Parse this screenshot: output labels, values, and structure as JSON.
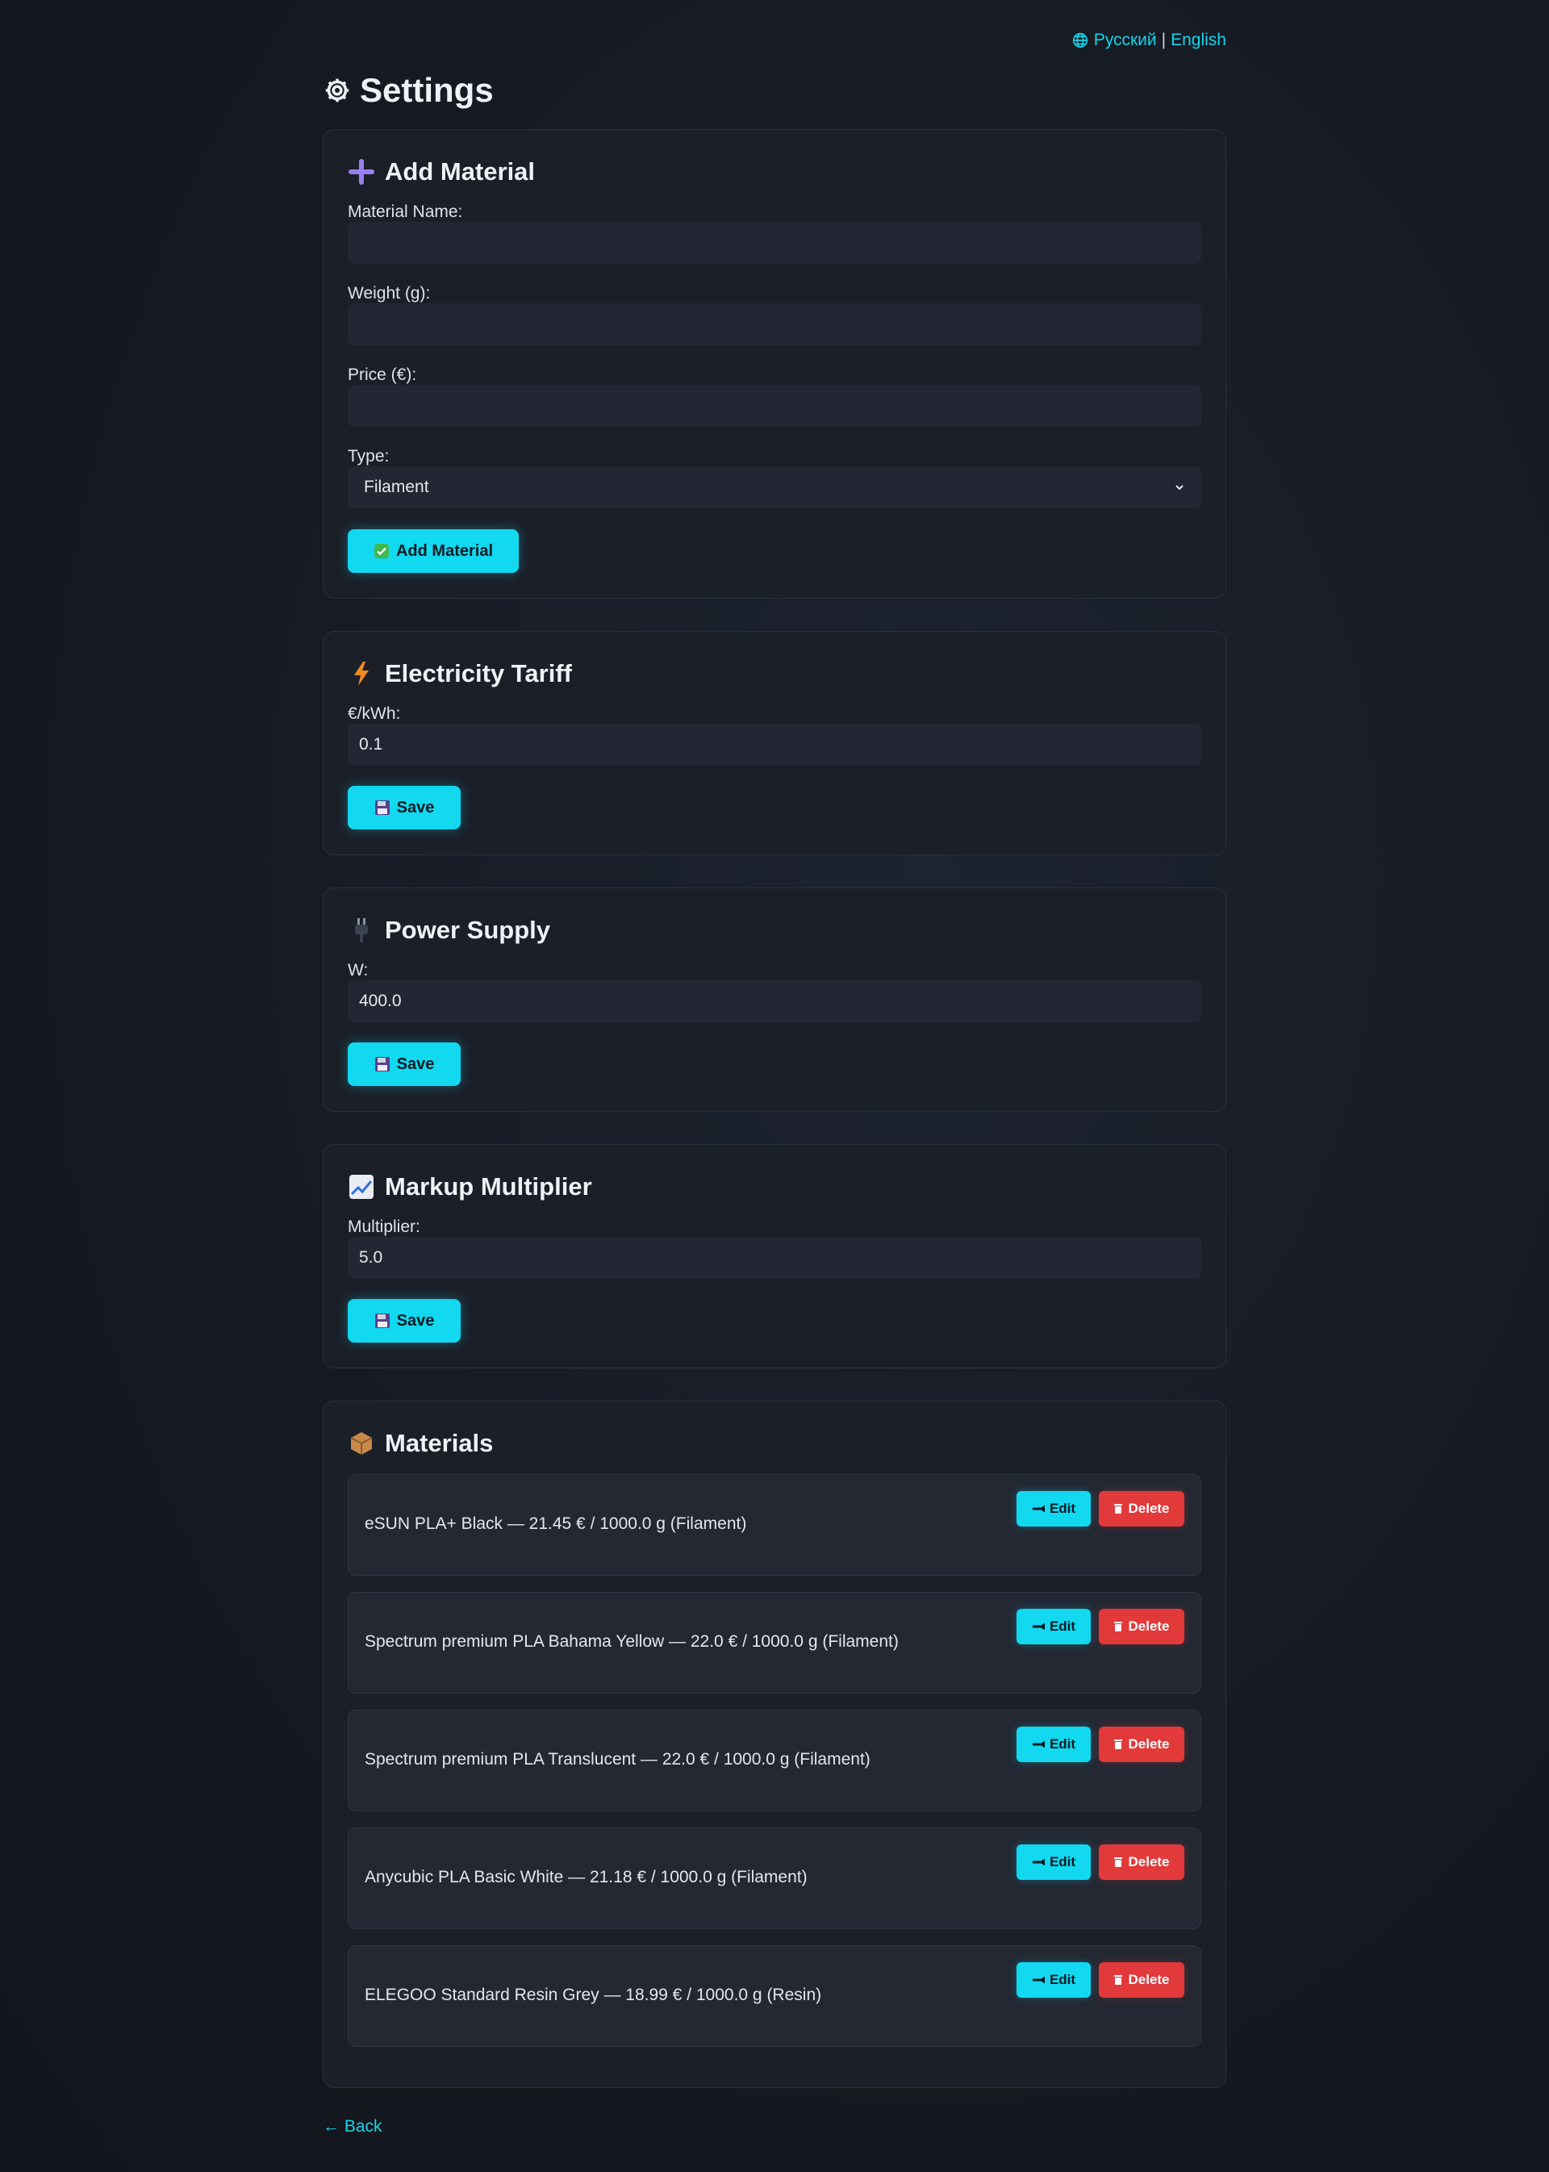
{
  "language": {
    "option_ru": "Русский",
    "separator": "|",
    "option_en": "English",
    "icon": "globe-icon"
  },
  "page": {
    "title": "Settings",
    "icon": "gear-icon"
  },
  "add_material": {
    "title": "Add Material",
    "icon": "plus-icon",
    "name_label": "Material Name:",
    "name_value": "",
    "weight_label": "Weight (g):",
    "weight_value": "",
    "price_label": "Price (€):",
    "price_value": "",
    "type_label": "Type:",
    "type_selected": "Filament",
    "submit_label": "Add Material",
    "submit_icon": "check-icon"
  },
  "electricity": {
    "title": "Electricity Tariff",
    "icon": "lightning-icon",
    "field_label": "€/kWh:",
    "field_value": "0.1",
    "save_label": "Save"
  },
  "power_supply": {
    "title": "Power Supply",
    "icon": "plug-icon",
    "field_label": "W:",
    "field_value": "400.0",
    "save_label": "Save"
  },
  "markup": {
    "title": "Markup Multiplier",
    "icon": "chart-icon",
    "field_label": "Multiplier:",
    "field_value": "5.0",
    "save_label": "Save"
  },
  "materials": {
    "title": "Materials",
    "icon": "package-icon",
    "edit_label": "Edit",
    "delete_label": "Delete",
    "items": [
      {
        "text": "eSUN PLA+ Black — 21.45 € / 1000.0 g (Filament)"
      },
      {
        "text": "Spectrum premium PLA Bahama Yellow — 22.0 € / 1000.0 g (Filament)"
      },
      {
        "text": "Spectrum premium PLA Translucent — 22.0 € / 1000.0 g (Filament)"
      },
      {
        "text": "Anycubic PLA Basic White — 21.18 € / 1000.0 g (Filament)"
      },
      {
        "text": "ELEGOO Standard Resin Grey — 18.99 € / 1000.0 g (Resin)"
      }
    ]
  },
  "footer": {
    "back_label": "← Back"
  },
  "colors": {
    "accent": "#12d8f0",
    "danger": "#e2393b",
    "background": "#161a22",
    "card": "#1b1f28"
  }
}
